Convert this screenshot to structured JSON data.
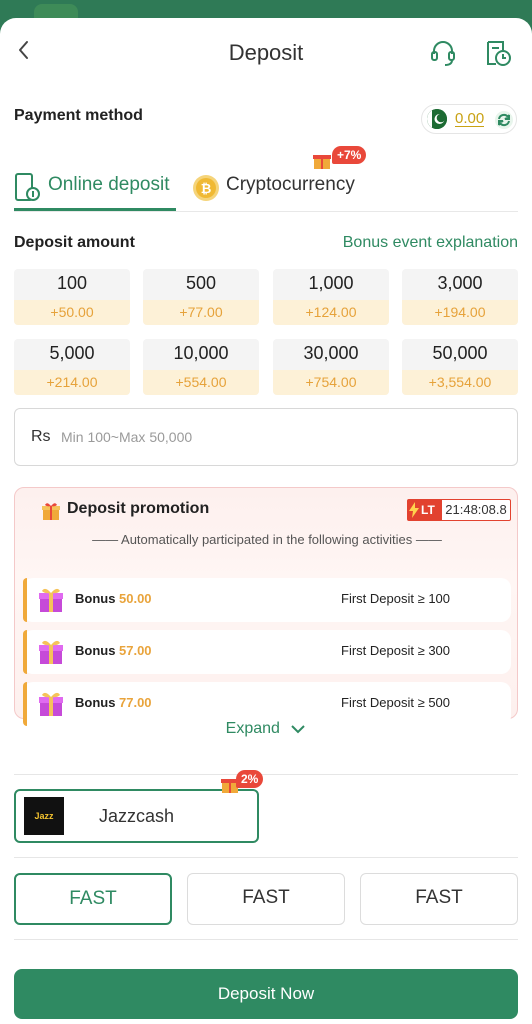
{
  "header": {
    "title": "Deposit"
  },
  "payment": {
    "label": "Payment method",
    "balance": "0.00"
  },
  "tabs": [
    {
      "label": "Online deposit",
      "active": true
    },
    {
      "label": "Cryptocurrency",
      "active": false,
      "badge": "+7%"
    }
  ],
  "deposit": {
    "label": "Deposit amount",
    "bonus_link": "Bonus event explanation",
    "amounts": [
      {
        "value": "100",
        "bonus": "+50.00"
      },
      {
        "value": "500",
        "bonus": "+77.00"
      },
      {
        "value": "1,000",
        "bonus": "+124.00"
      },
      {
        "value": "3,000",
        "bonus": "+194.00"
      },
      {
        "value": "5,000",
        "bonus": "+214.00"
      },
      {
        "value": "10,000",
        "bonus": "+554.00"
      },
      {
        "value": "30,000",
        "bonus": "+754.00"
      },
      {
        "value": "50,000",
        "bonus": "+3,554.00"
      }
    ]
  },
  "input": {
    "prefix": "Rs",
    "placeholder": "Min 100~Max 50,000",
    "value": ""
  },
  "promotion": {
    "title": "Deposit promotion",
    "timer_badge": "LT",
    "timer": "21:48:08.8",
    "subtitle": "—— Automatically participated in the following activities ——",
    "rows": [
      {
        "label": "Bonus",
        "value": "50.00",
        "condition": "First Deposit ≥ 100"
      },
      {
        "label": "Bonus",
        "value": "57.00",
        "condition": "First Deposit ≥ 300"
      },
      {
        "label": "Bonus",
        "value": "77.00",
        "condition": "First Deposit ≥ 500"
      }
    ],
    "expand_label": "Expand"
  },
  "channel": {
    "label": "Jazzcash",
    "badge": "2%",
    "logo_text": "JazzCash"
  },
  "speeds": [
    {
      "label": "FAST",
      "selected": true
    },
    {
      "label": "FAST",
      "selected": false
    },
    {
      "label": "FAST",
      "selected": false
    }
  ],
  "action": {
    "label": "Deposit Now"
  },
  "colors": {
    "accent": "#2f8a62",
    "bonus": "#e6a23a",
    "badge": "#e9483a"
  },
  "icons": [
    "back-arrow-icon",
    "headset-icon",
    "history-clock-icon",
    "pakistan-flag-icon",
    "refresh-icon",
    "phone-deposit-icon",
    "bitcoin-icon",
    "gift-icon",
    "lightning-icon",
    "chevron-down-icon"
  ]
}
